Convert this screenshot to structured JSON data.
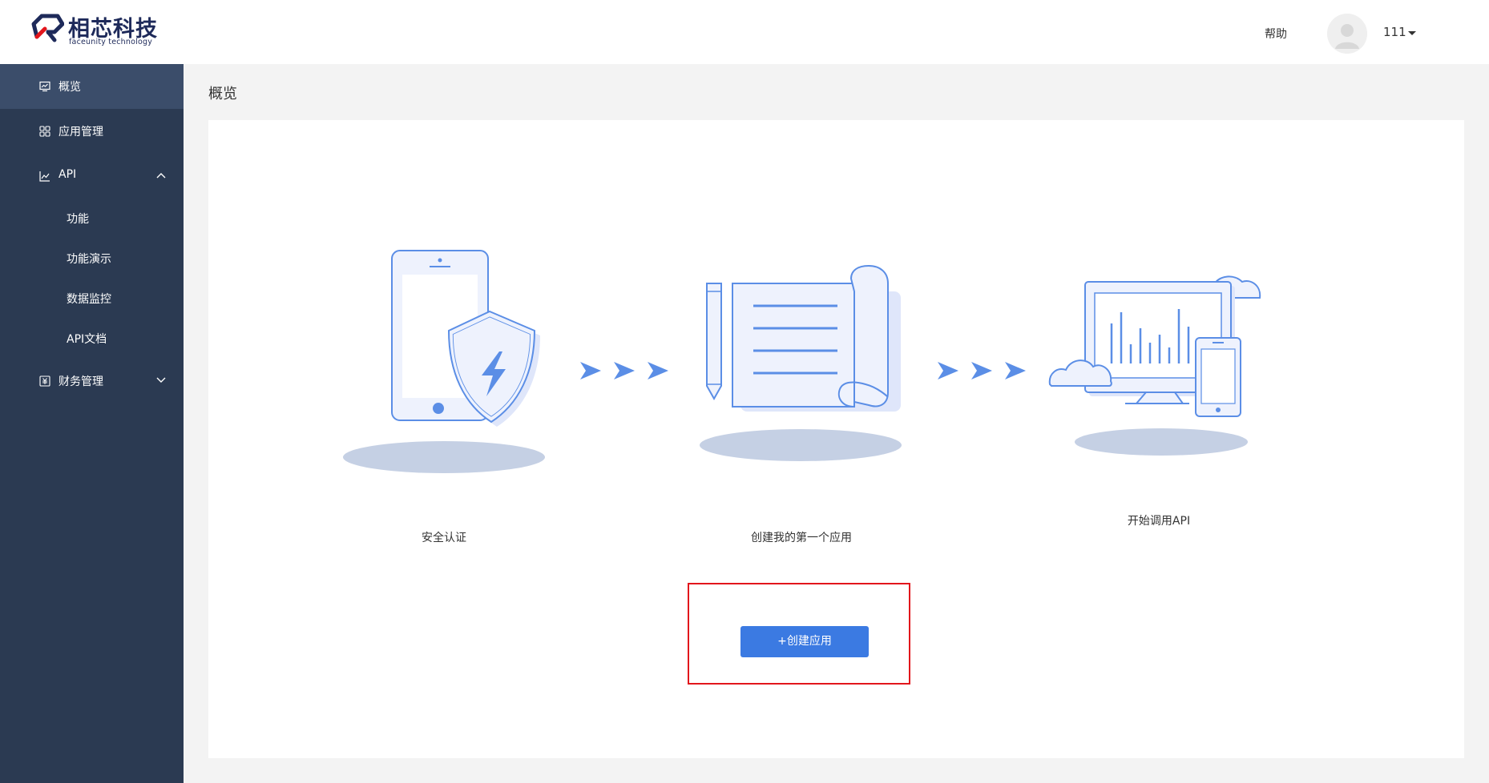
{
  "header": {
    "logo_cn": "相芯科技",
    "logo_en": "faceunity technology",
    "help_label": "帮助",
    "user_name": "111"
  },
  "sidebar": {
    "items": [
      {
        "label": "概览",
        "icon": "dashboard-icon",
        "active": true
      },
      {
        "label": "应用管理",
        "icon": "apps-grid-icon"
      },
      {
        "label": "API",
        "icon": "line-chart-icon",
        "expanded": true,
        "children": [
          "功能",
          "功能演示",
          "数据监控",
          "API文档"
        ]
      },
      {
        "label": "财务管理",
        "icon": "finance-icon",
        "expanded": false
      }
    ]
  },
  "main": {
    "page_title": "概览",
    "steps": [
      {
        "label": "安全认证",
        "illustration": "phone-shield-illustration"
      },
      {
        "label": "创建我的第一个应用",
        "illustration": "document-scroll-illustration"
      },
      {
        "label": "开始调用API",
        "illustration": "monitor-cloud-illustration"
      }
    ],
    "create_button_label": "+创建应用"
  },
  "colors": {
    "sidebar_bg": "#2b3a52",
    "sidebar_active": "#3b4d6a",
    "primary": "#3b7ae2",
    "highlight": "#e2161c",
    "illustration_stroke": "#5b8ee6",
    "illustration_fill": "#e6ebfb",
    "shadow": "#c5d0e4"
  }
}
